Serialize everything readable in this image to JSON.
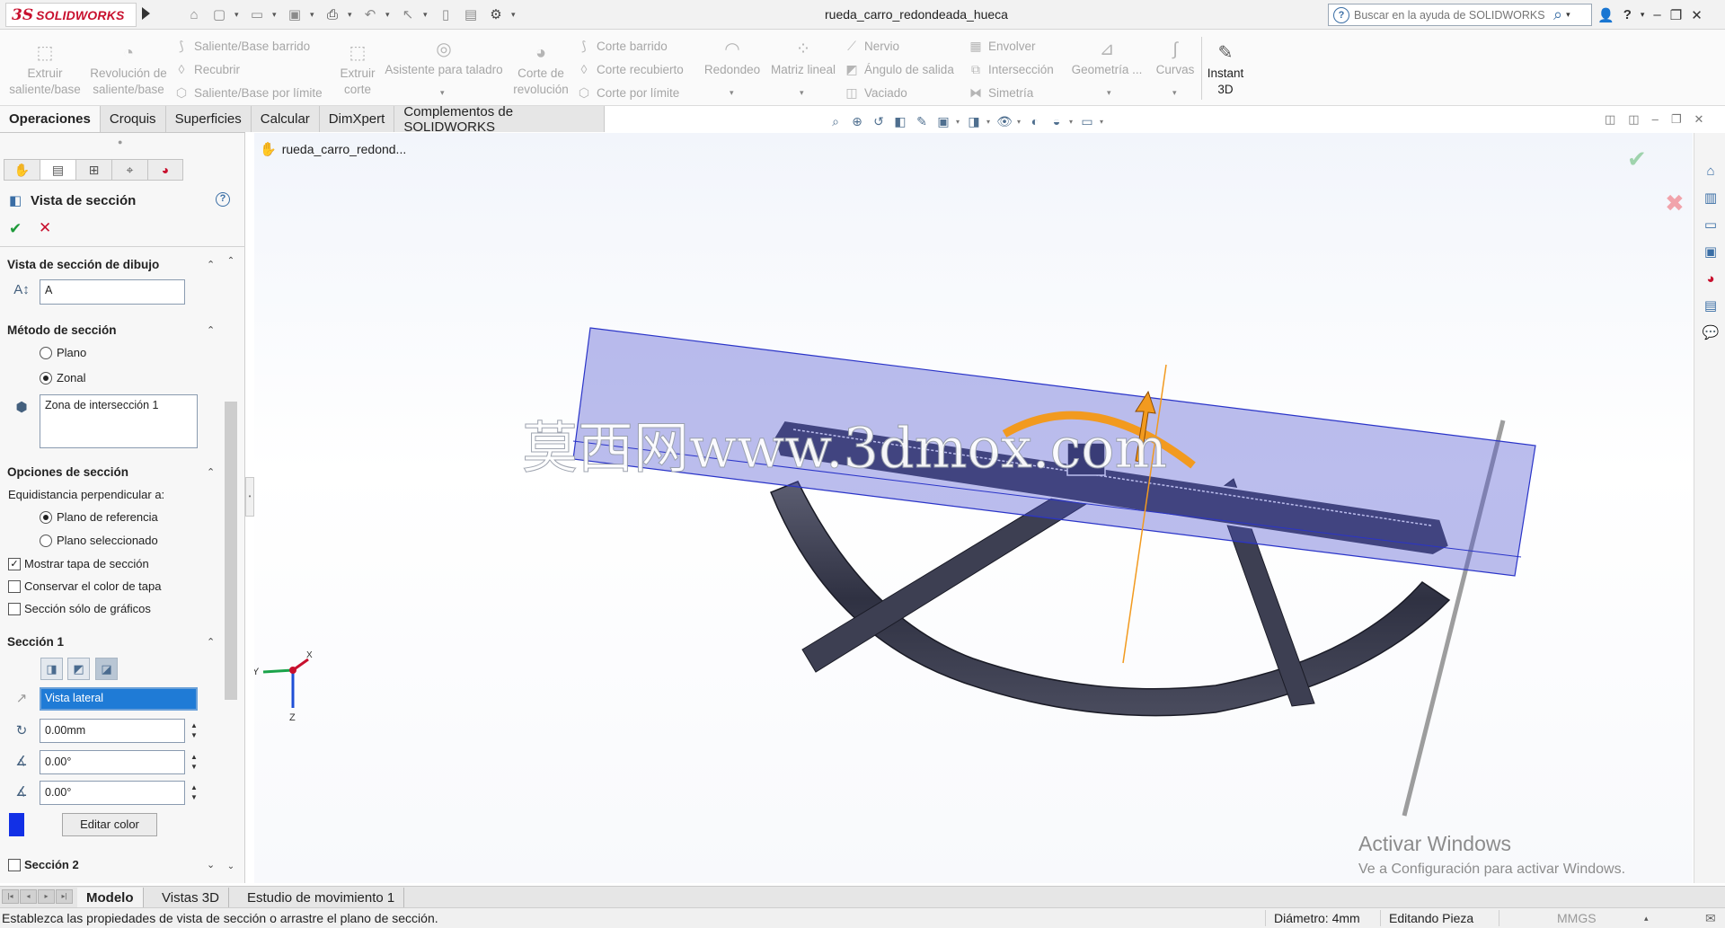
{
  "app": {
    "brand_ds": "3S",
    "brand_name": "SOLIDWORKS",
    "document_title": "rueda_carro_redondeada_hueca",
    "search_placeholder": "Buscar en la ayuda de SOLIDWORKS",
    "accent_color": "#c8102e"
  },
  "quick_access": [
    "home-icon",
    "new-icon",
    "open-icon",
    "save-icon",
    "print-icon",
    "undo-icon",
    "select-icon",
    "rebuild-icon",
    "file-props-icon",
    "options-icon"
  ],
  "ribbon": {
    "extrude_boss": "Extruir\nsaliente/base",
    "revolve_boss": "Revolución de\nsaliente/base",
    "swept_boss": "Saliente/Base barrido",
    "lofted": "Recubrir",
    "boundary_boss": "Saliente/Base por límite",
    "extrude_cut": "Extruir\ncorte",
    "hole_wizard": "Asistente para taladro",
    "revolve_cut": "Corte de\nrevolución",
    "swept_cut": "Corte barrido",
    "lofted_cut": "Corte recubierto",
    "boundary_cut": "Corte por límite",
    "fillet": "Redondeo",
    "linear_pattern": "Matriz lineal",
    "rib": "Nervio",
    "draft": "Ángulo de salida",
    "shell": "Vaciado",
    "wrap": "Envolver",
    "intersect": "Intersección",
    "mirror": "Simetría",
    "reference_geometry": "Geometría ...",
    "curves": "Curvas",
    "instant3d": "Instant\n3D"
  },
  "command_tabs": [
    "Operaciones",
    "Croquis",
    "Superficies",
    "Calcular",
    "DimXpert",
    "Complementos de SOLIDWORKS"
  ],
  "feature_tree": {
    "part_name": "rueda_carro_redond..."
  },
  "property_manager": {
    "title": "Vista de sección",
    "drawing_section": {
      "header": "Vista de sección de dibujo",
      "name_value": "A"
    },
    "method": {
      "header": "Método de sección",
      "plane_label": "Plano",
      "zonal_label": "Zonal",
      "selected": "Zonal",
      "zone_value": "Zona de intersección 1"
    },
    "options": {
      "header": "Opciones de sección",
      "offset_label": "Equidistancia perpendicular a:",
      "ref_plane_label": "Plano de referencia",
      "sel_plane_label": "Plano seleccionado",
      "offset_selected": "Plano de referencia",
      "show_cap_label": "Mostrar tapa de sección",
      "show_cap": true,
      "keep_cap_color_label": "Conservar el color de tapa",
      "keep_cap_color": false,
      "graphics_only_label": "Sección sólo de gráficos",
      "graphics_only": false
    },
    "section1": {
      "header": "Sección 1",
      "plane_value": "Vista lateral",
      "offset_value": "0.00mm",
      "angle_x": "0.00°",
      "angle_y": "0.00°",
      "color": "#1230e6",
      "edit_color_label": "Editar color"
    },
    "section2": {
      "header": "Sección 2",
      "enabled": false
    }
  },
  "triad": {
    "x_label": "X",
    "y_label": "Y",
    "z_label": "Z"
  },
  "watermark": "莫西网www.3dmox.com",
  "activate_windows": {
    "title": "Activar Windows",
    "subtitle": "Ve a Configuración para activar Windows."
  },
  "bottom_tabs": [
    "Modelo",
    "Vistas 3D",
    "Estudio de movimiento 1"
  ],
  "status": {
    "message": "Establezca las propiedades de vista de sección o arrastre el plano de sección.",
    "diameter": "Diámetro: 4mm",
    "mode": "Editando Pieza",
    "units": "MMGS"
  }
}
